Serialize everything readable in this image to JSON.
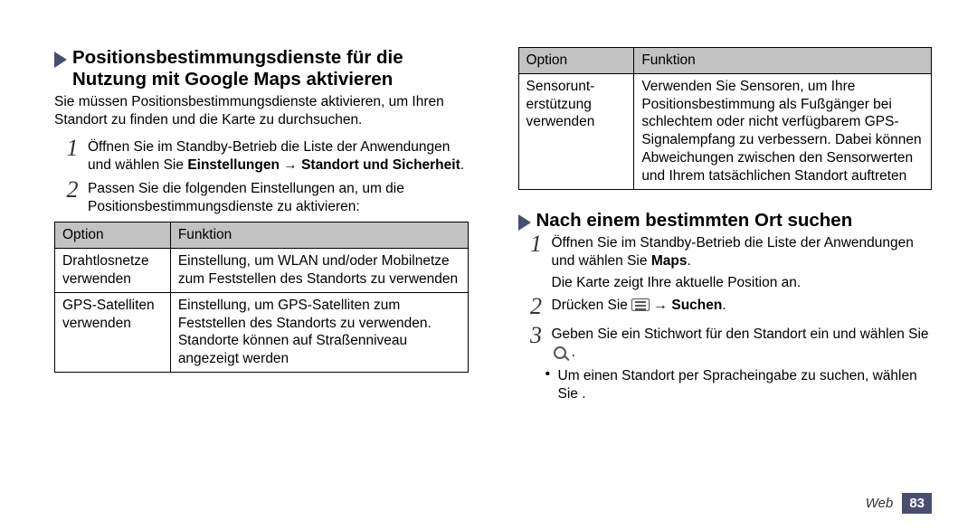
{
  "left": {
    "h1": "Positionsbestimmungsdienste für die Nutzung mit Google Maps aktivieren",
    "intro": "Sie müssen Positionsbestimmungsdienste aktivieren, um Ihren Standort zu finden und die Karte zu durchsuchen.",
    "step1_pre": "Öffnen Sie im Standby-Betrieb die Liste der Anwendungen und wählen Sie ",
    "step1_b1": "Einstellungen",
    "step1_arrow": " → ",
    "step1_b2": "Standort und Sicherheit",
    "step1_post": ".",
    "step2": "Passen Sie die folgenden Einstellungen an, um die Positionsbestimmungsdienste zu aktivieren:",
    "table": {
      "h1": "Option",
      "h2": "Funktion",
      "r1c1": "Drahtlosnetze verwenden",
      "r1c2": "Einstellung, um WLAN und/oder Mobilnetze zum Feststellen des Standorts zu verwenden",
      "r2c1": "GPS-Satelliten verwenden",
      "r2c2": "Einstellung, um GPS-Satelliten zum Feststellen des Standorts zu verwenden. Standorte können auf Straßenniveau angezeigt werden"
    }
  },
  "right": {
    "table": {
      "h1": "Option",
      "h2": "Funktion",
      "r1c1": "Sensorunt­erstützung verwenden",
      "r1c2": "Verwenden Sie Sensoren, um Ihre Positionsbestimmung als Fußgänger bei schlechtem oder nicht verfügbarem GPS-Signalempfang zu verbessern. Dabei können Abweichungen zwischen den Sensorwerten und Ihrem tatsächlichen Standort auftreten"
    },
    "h2": "Nach einem bestimmten Ort suchen",
    "s1_pre": "Öffnen Sie im Standby-Betrieb die Liste der Anwendungen und wählen Sie ",
    "s1_b": "Maps",
    "s1_post": ".",
    "s1_note": "Die Karte zeigt Ihre aktuelle Position an.",
    "s2_pre": "Drücken Sie ",
    "s2_arrow": " → ",
    "s2_b": "Suchen",
    "s2_post": ".",
    "s3_pre": "Geben Sie ein Stichwort für den Standort ein und wählen Sie ",
    "s3_post": " .",
    "s3_sub": "Um einen Standort per Spracheingabe zu suchen, wählen Sie      ."
  },
  "footer": {
    "label": "Web",
    "page": "83"
  }
}
